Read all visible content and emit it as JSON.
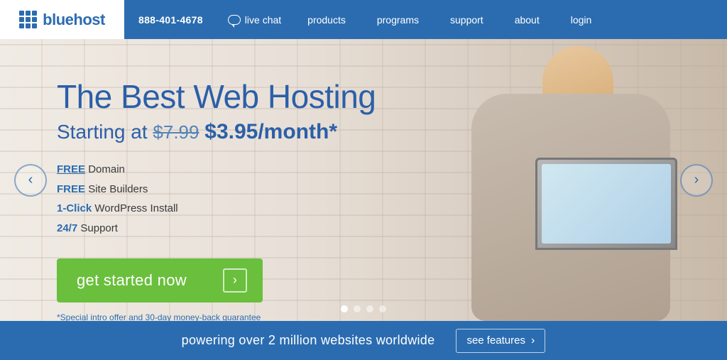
{
  "header": {
    "logo_text": "bluehost",
    "phone": "888-401-4678",
    "live_chat": "live chat",
    "nav_items": [
      {
        "label": "products",
        "id": "products"
      },
      {
        "label": "programs",
        "id": "programs"
      },
      {
        "label": "support",
        "id": "support"
      },
      {
        "label": "about",
        "id": "about"
      },
      {
        "label": "login",
        "id": "login"
      }
    ]
  },
  "hero": {
    "title": "The Best Web Hosting",
    "subtitle_prefix": "Starting at ",
    "price_old": "$7.99",
    "price_new": "$3.95/month*",
    "features": [
      {
        "highlight": "FREE",
        "text": " Domain"
      },
      {
        "highlight": "FREE",
        "text": " Site Builders"
      },
      {
        "highlight": "1-Click",
        "text": " WordPress Install"
      },
      {
        "highlight": "24/7",
        "text": " Support"
      }
    ],
    "cta_label": "get started now",
    "disclaimer": "*Special intro offer and 30-day money-back guarantee",
    "dots": [
      true,
      false,
      false,
      false
    ]
  },
  "footer": {
    "text": "powering over 2 million websites worldwide",
    "cta_label": "see features"
  }
}
